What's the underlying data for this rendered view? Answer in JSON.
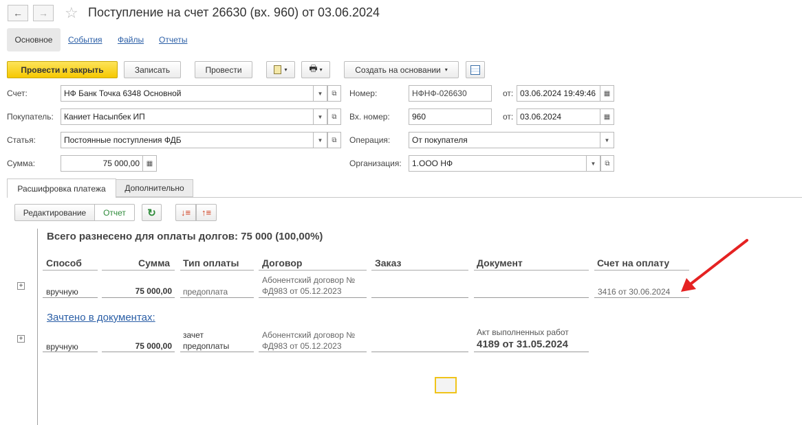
{
  "window": {
    "title": "Поступление на счет 26630 (вх. 960) от 03.06.2024"
  },
  "nav_tabs": {
    "main": "Основное",
    "events": "События",
    "files": "Файлы",
    "reports": "Отчеты"
  },
  "toolbar": {
    "post_close": "Провести и закрыть",
    "save": "Записать",
    "post": "Провести",
    "create_based": "Создать на основании"
  },
  "form": {
    "account_label": "Счет:",
    "account_value": "НФ Банк Точка 6348 Основной",
    "buyer_label": "Покупатель:",
    "buyer_value": "Каниет Насыпбек ИП",
    "article_label": "Статья:",
    "article_value": "Постоянные поступления ФДБ",
    "sum_label": "Сумма:",
    "sum_value": "75 000,00",
    "number_label": "Номер:",
    "number_value": "НФНФ-026630",
    "date_label": "от:",
    "date_value": "03.06.2024 19:49:46",
    "in_number_label": "Вх. номер:",
    "in_number_value": "960",
    "in_date_label": "от:",
    "in_date_value": "03.06.2024",
    "operation_label": "Операция:",
    "operation_value": "От покупателя",
    "org_label": "Организация:",
    "org_value": "1.ООО НФ"
  },
  "section_tabs": {
    "breakdown": "Расшифровка платежа",
    "additional": "Дополнительно"
  },
  "subtoolbar": {
    "edit": "Редактирование",
    "report": "Отчет"
  },
  "summary": {
    "text": "Всего разнесено для оплаты долгов: 75 000  (100,00%)"
  },
  "table": {
    "headers": [
      "Способ",
      "Сумма",
      "Тип оплаты",
      "Договор",
      "Заказ",
      "Документ",
      "Счет на оплату"
    ],
    "row1": {
      "method": "вручную",
      "sum": "75 000,00",
      "pay_type": "предоплата",
      "contract_line1": "Абонентский договор №",
      "contract_line2": "ФД983 от 05.12.2023",
      "invoice": "3416 от 30.06.2024"
    },
    "offset_link": "Зачтено в документах:",
    "row2": {
      "method": "вручную",
      "sum": "75 000,00",
      "pay_type_line1": "зачет",
      "pay_type_line2": "предоплаты",
      "contract_line1": "Абонентский договор №",
      "contract_line2": "ФД983 от 05.12.2023",
      "doc_line1": "Акт выполненных работ",
      "doc_line2": "4189 от 31.05.2024"
    }
  },
  "colors": {
    "accent_yellow": "#f6c800",
    "link_blue": "#2a5ea6",
    "arrow_red": "#e52222",
    "report_green": "#2e8b3a"
  },
  "icons": [
    "back-icon",
    "forward-icon",
    "star-icon",
    "document-add-icon",
    "print-icon",
    "structure-icon",
    "dropdown-icon",
    "open-icon",
    "calendar-icon",
    "calculator-icon",
    "refresh-icon",
    "sort-desc-icon",
    "sort-asc-icon",
    "expand-icon"
  ]
}
